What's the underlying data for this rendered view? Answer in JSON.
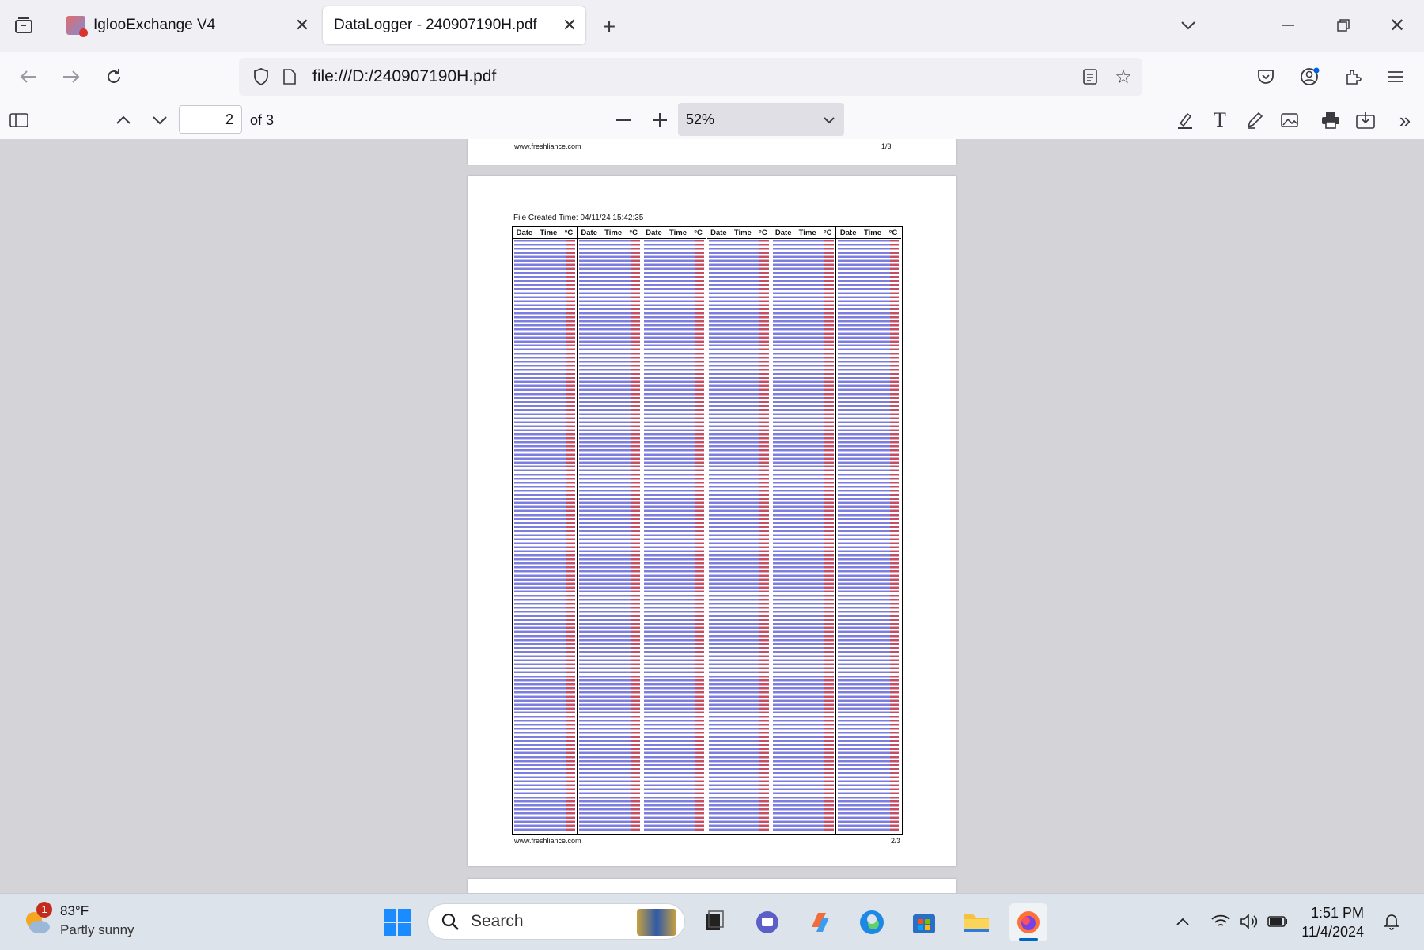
{
  "tabs": [
    {
      "title": "IglooExchange V4",
      "active": false
    },
    {
      "title": "DataLogger - 240907190H.pdf",
      "active": true
    }
  ],
  "address_bar": {
    "url": "file:///D:/240907190H.pdf"
  },
  "pdf_toolbar": {
    "current_page": "2",
    "page_count_label": "of 3",
    "zoom": "52%"
  },
  "document": {
    "prev_page_footer": {
      "site": "www.freshliance.com",
      "page": "1/3"
    },
    "page2": {
      "created_label": "File Created Time: 04/11/24 15:42:35",
      "column_header": {
        "date": "Date",
        "time": "Time",
        "unit": "°C"
      },
      "column_count": 6,
      "footer_site": "www.freshliance.com",
      "footer_page": "2/3"
    }
  },
  "taskbar": {
    "weather": {
      "temp": "83°F",
      "condition": "Partly sunny",
      "badge": "1"
    },
    "search_label": "Search",
    "time": "1:51 PM",
    "date": "11/4/2024"
  },
  "colors": {
    "accent_blue": "#0060df",
    "data_blue": "#3333cc",
    "data_red": "#e03030"
  }
}
